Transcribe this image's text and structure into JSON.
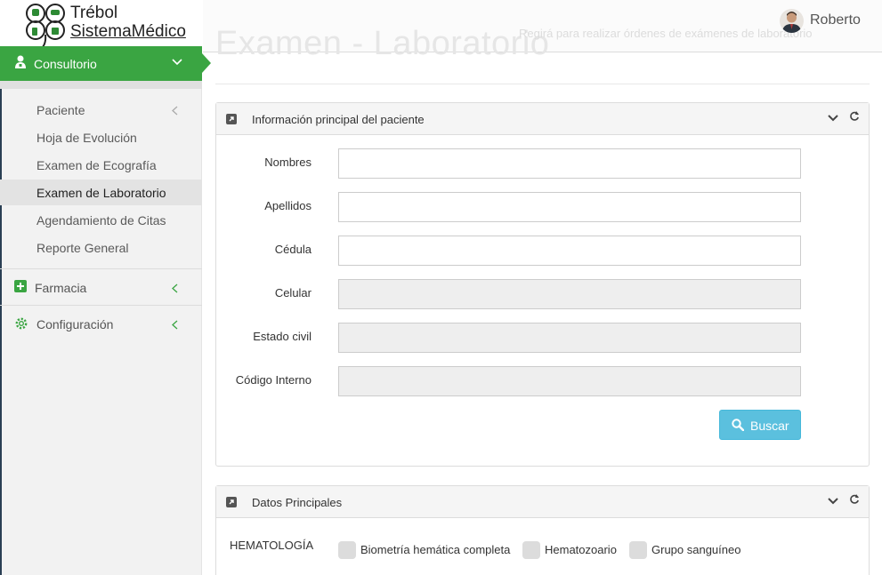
{
  "brand": {
    "line1": "Trébol",
    "line2": "SistemaMédico"
  },
  "sidebar": {
    "active_section": {
      "label": "Consultorio",
      "icon": "user-md-icon"
    },
    "sub_items": [
      {
        "label": "Paciente"
      },
      {
        "label": "Hoja de Evolución"
      },
      {
        "label": "Examen de Ecografía"
      },
      {
        "label": "Examen de Laboratorio"
      },
      {
        "label": "Agendamiento de Citas"
      },
      {
        "label": "Reporte General"
      }
    ],
    "sections": [
      {
        "label": "Farmacia",
        "icon": "plus-square-icon"
      },
      {
        "label": "Configuración",
        "icon": "gear-icon"
      }
    ]
  },
  "header": {
    "title": "Examen - Laboratorio",
    "subtitle": "Regirá para realizar órdenes de exámenes de laboratorio",
    "user_name": "Roberto"
  },
  "panel_patient": {
    "title": "Información principal del paciente",
    "fields": [
      {
        "label": "Nombres",
        "value": "",
        "readonly": false
      },
      {
        "label": "Apellidos",
        "value": "",
        "readonly": false
      },
      {
        "label": "Cédula",
        "value": "",
        "readonly": false
      },
      {
        "label": "Celular",
        "value": "",
        "readonly": true
      },
      {
        "label": "Estado civil",
        "value": "",
        "readonly": true
      },
      {
        "label": "Código Interno",
        "value": "",
        "readonly": true
      }
    ],
    "search_button": "Buscar"
  },
  "panel_data": {
    "title": "Datos Principales",
    "section_label": "HEMATOLOGÍA",
    "options": [
      {
        "label": "Biometría hemática completa",
        "checked": false
      },
      {
        "label": "Hematozoario",
        "checked": false
      },
      {
        "label": "Grupo sanguíneo",
        "checked": false
      }
    ]
  },
  "colors": {
    "accent": "#3aa542",
    "info_button": "#5bc0de",
    "sidebar_bg": "#f2f2f2"
  }
}
